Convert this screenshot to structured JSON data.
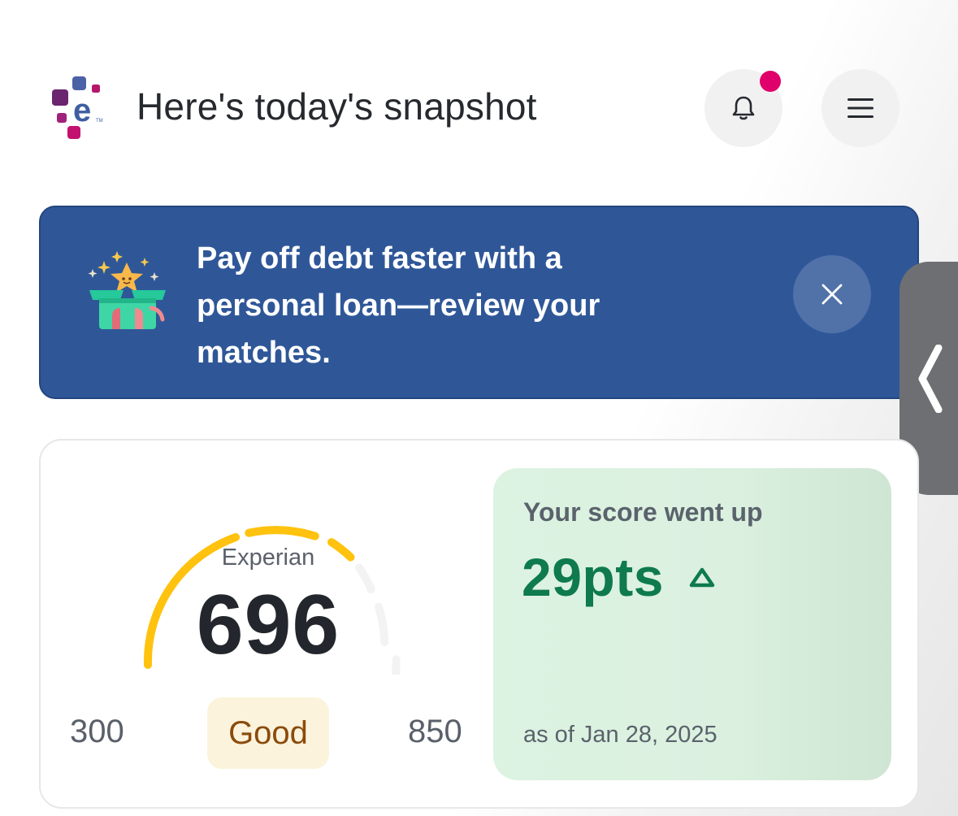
{
  "header": {
    "title": "Here's today's snapshot",
    "logo_icon": "experian-logo",
    "notification_icon": "bell-icon",
    "menu_icon": "hamburger-menu-icon",
    "notification_dot_color": "#e0006c"
  },
  "promo": {
    "text": "Pay off debt faster with a personal loan—review your matches.",
    "illustration": "gift-box-star-icon",
    "close_icon": "close-icon",
    "background_color": "#2f5798"
  },
  "side_handle": {
    "icon": "chevron-left-icon"
  },
  "score": {
    "bureau": "Experian",
    "value": "696",
    "range_min": "300",
    "range_max": "850",
    "rating": "Good",
    "gauge_color": "#ffc20e"
  },
  "score_change": {
    "heading": "Your score went up",
    "value": "29pts",
    "direction_icon": "triangle-up-icon",
    "as_of": "as of Jan 28, 2025",
    "value_color": "#0e7a4d"
  }
}
